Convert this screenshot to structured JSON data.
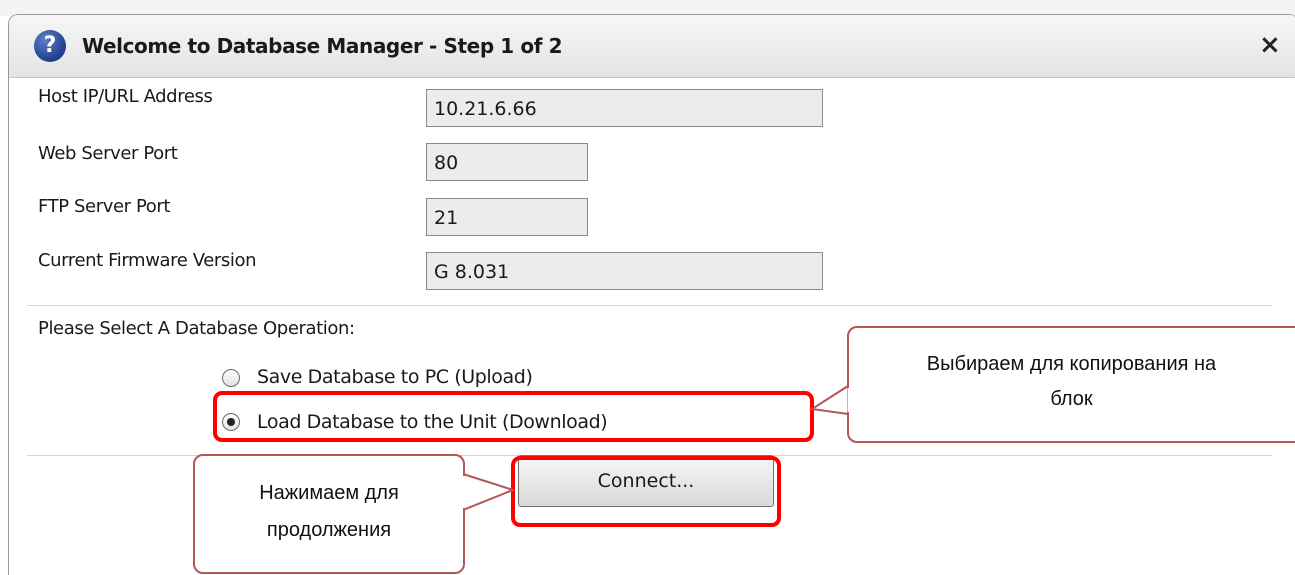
{
  "dialog": {
    "title": "Welcome to Database Manager - Step 1 of 2",
    "help_icon": "?",
    "close_icon": "×"
  },
  "fields": [
    {
      "label": "Host IP/URL Address",
      "value": "10.21.6.66"
    },
    {
      "label": "Web Server Port",
      "value": "80"
    },
    {
      "label": "FTP Server Port",
      "value": "21"
    },
    {
      "label": "Current Firmware Version",
      "value": "G 8.031"
    }
  ],
  "operation": {
    "prompt": "Please Select A Database Operation:",
    "options": [
      {
        "label": "Save Database to PC (Upload)",
        "selected": false
      },
      {
        "label": "Load Database to the Unit (Download)",
        "selected": true
      }
    ]
  },
  "connect_button": {
    "label": "Connect..."
  },
  "annotations": {
    "select_note_line1": "Выбираем для копирования на",
    "select_note_line2": "блок",
    "connect_note_line1": "Нажимаем для",
    "connect_note_line2": "продолжения",
    "highlight_color": "#ff0000",
    "callout_border_color": "#b55656"
  }
}
